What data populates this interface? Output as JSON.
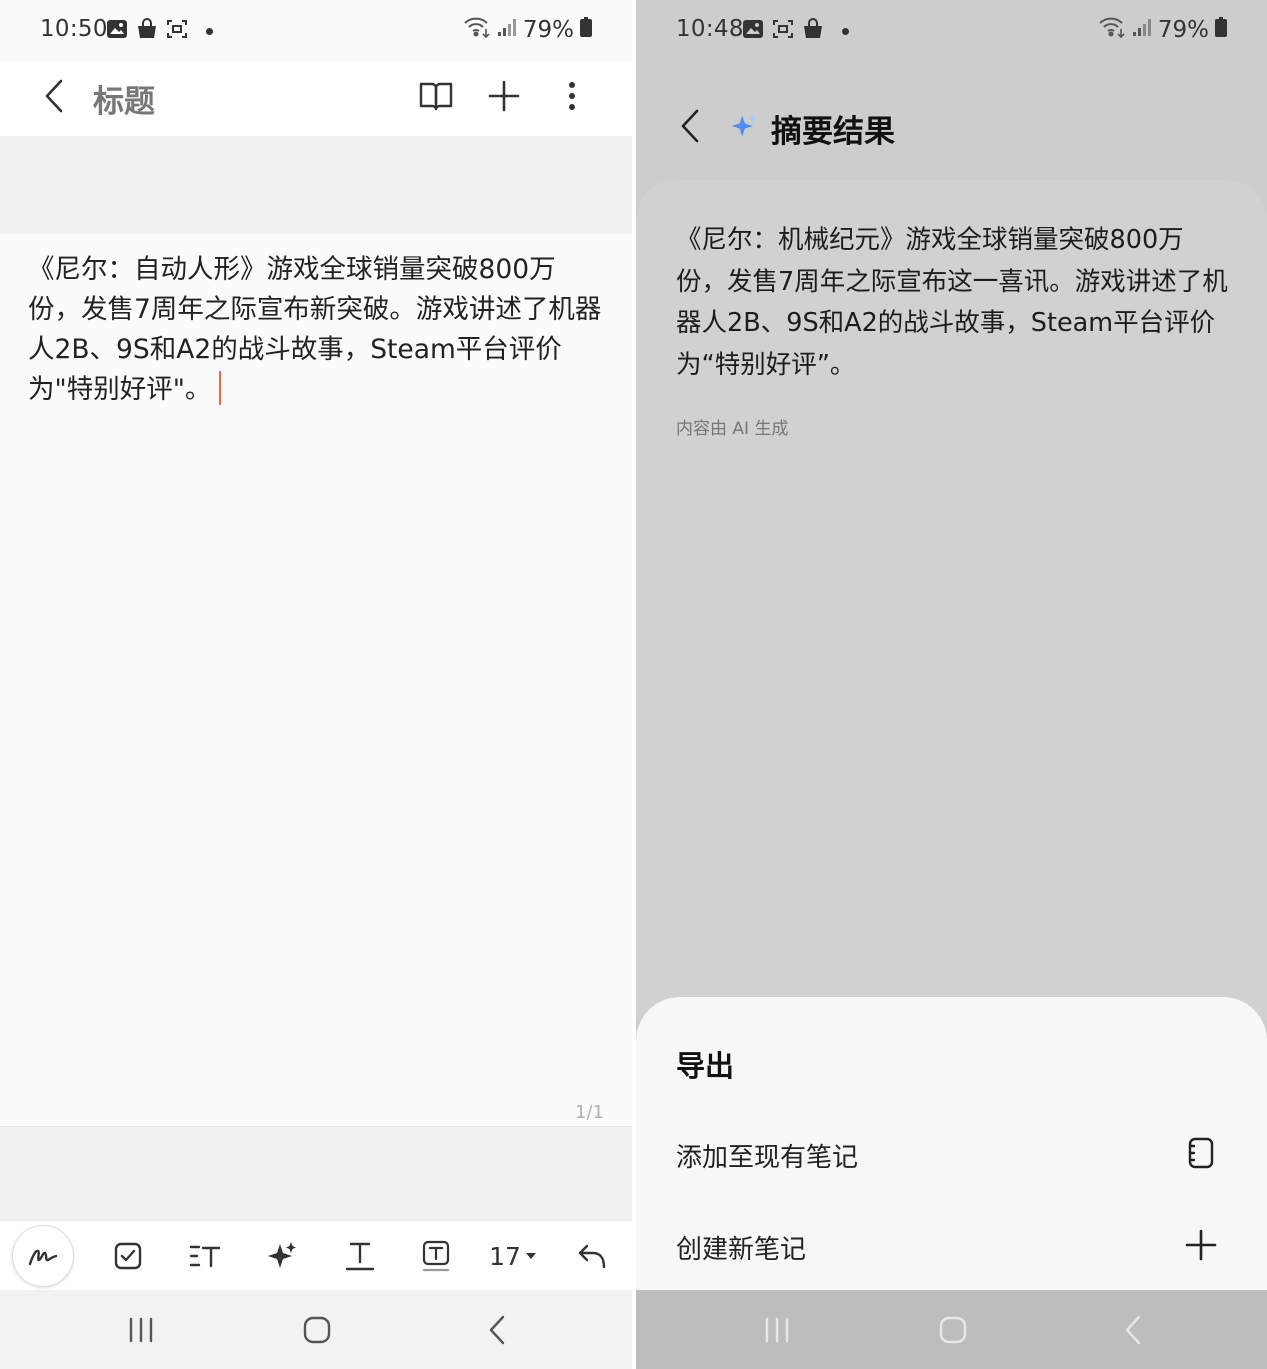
{
  "left": {
    "status": {
      "time": "10:50",
      "battery": "79%"
    },
    "header": {
      "title_placeholder": "标题"
    },
    "note": {
      "text": "《尼尔：自动人形》游戏全球销量突破800万份，发售7周年之际宣布新突破。游戏讲述了机器人2B、9S和A2的战斗故事，Steam平台评价为\"特别好评\"。"
    },
    "page_indicator": "1/1",
    "toolbar": {
      "font_size": "17"
    }
  },
  "right": {
    "status": {
      "time": "10:48",
      "battery": "79%"
    },
    "header": {
      "title": "摘要结果"
    },
    "summary": {
      "text": "《尼尔：机械纪元》游戏全球销量突破800万份，发售7周年之际宣布这一喜讯。游戏讲述了机器人2B、9S和A2的战斗故事，Steam平台评价为“特别好评”。",
      "ai_note": "内容由 AI 生成"
    },
    "export_sheet": {
      "title": "导出",
      "items": [
        {
          "label": "添加至现有笔记",
          "icon": "notebook-icon"
        },
        {
          "label": "创建新笔记",
          "icon": "plus-icon"
        }
      ]
    }
  },
  "icons": {
    "status_left": [
      "gallery-icon",
      "shopping-bag-icon",
      "screenshot-icon"
    ],
    "status_right": [
      "wifi-icon",
      "signal-icon",
      "battery-icon"
    ],
    "header": [
      "back-icon",
      "book-icon",
      "plus-icon",
      "more-icon"
    ],
    "toolbar": [
      "pen-icon",
      "checkbox-icon",
      "text-style-icon",
      "ai-sparkle-icon",
      "text-underline-icon",
      "text-box-icon",
      "undo-icon"
    ],
    "nav": [
      "recent-apps-icon",
      "home-icon",
      "nav-back-icon"
    ]
  },
  "colors": {
    "caret": "#e26a4f",
    "sparkle_blue": "#4f8ef7",
    "sparkle_light": "#9fd0ff"
  }
}
